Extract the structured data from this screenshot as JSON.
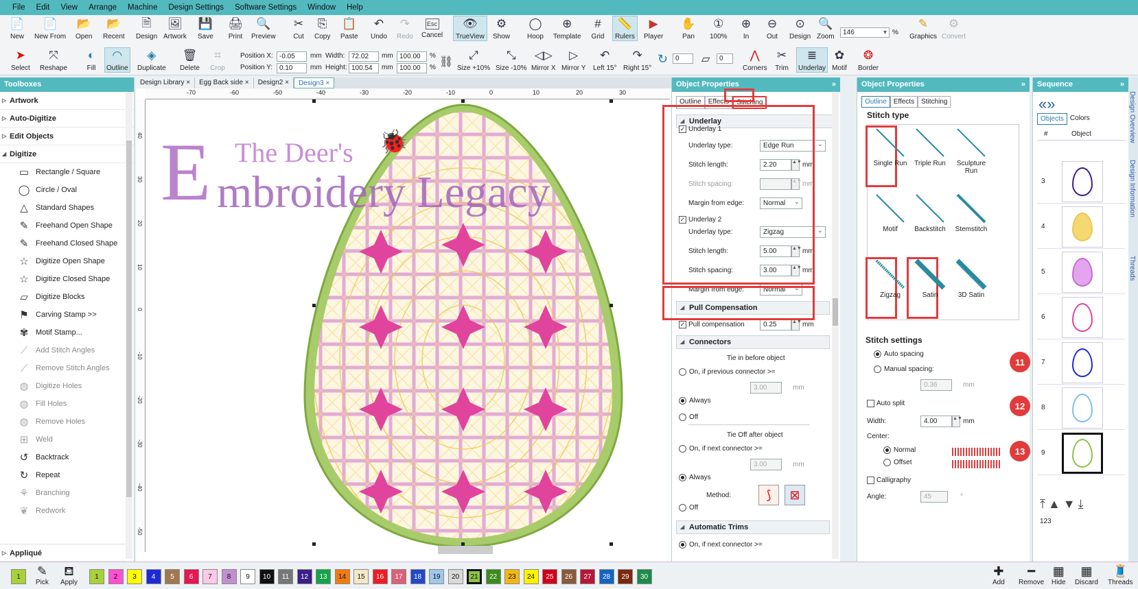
{
  "menu": [
    "File",
    "Edit",
    "View",
    "Arrange",
    "Machine",
    "Design Settings",
    "Software Settings",
    "Window",
    "Help"
  ],
  "toolbar1": [
    {
      "label": "New",
      "icon": "📄"
    },
    {
      "label": "New From",
      "icon": "📄"
    },
    {
      "label": "Open",
      "icon": "📂"
    },
    {
      "label": "Recent",
      "icon": "📂"
    },
    {
      "label": "Design",
      "icon": "🗎"
    },
    {
      "label": "Artwork",
      "icon": "🖼"
    },
    {
      "label": "Save",
      "icon": "💾"
    },
    {
      "label": "Print",
      "icon": "🖨"
    },
    {
      "label": "Preview",
      "icon": "🔍"
    },
    {
      "label": "Cut",
      "icon": "✂"
    },
    {
      "label": "Copy",
      "icon": "⎘"
    },
    {
      "label": "Paste",
      "icon": "📋"
    },
    {
      "label": "Undo",
      "icon": "↶"
    },
    {
      "label": "Redo",
      "icon": "↷"
    },
    {
      "label": "Cancel",
      "icon": "Esc"
    },
    {
      "label": "TrueView",
      "icon": "👁"
    },
    {
      "label": "Show",
      "icon": "⚙"
    },
    {
      "label": "Hoop",
      "icon": "◯"
    },
    {
      "label": "Template",
      "icon": "⊕"
    },
    {
      "label": "Grid",
      "icon": "#"
    },
    {
      "label": "Rulers",
      "icon": "📏"
    },
    {
      "label": "Player",
      "icon": "▶"
    },
    {
      "label": "Pan",
      "icon": "✋"
    },
    {
      "label": "100%",
      "icon": "①"
    },
    {
      "label": "In",
      "icon": "⊕"
    },
    {
      "label": "Out",
      "icon": "⊖"
    },
    {
      "label": "Design",
      "icon": "⊙"
    },
    {
      "label": "Zoom",
      "icon": "🔍"
    }
  ],
  "zoom_value": "146",
  "zoom_unit": "%",
  "graphics": "Graphics",
  "convert": "Convert",
  "toolbar2": [
    {
      "label": "Select",
      "icon": "➤"
    },
    {
      "label": "Reshape",
      "icon": "⤧"
    },
    {
      "label": "Fill",
      "icon": "◐"
    },
    {
      "label": "Outline",
      "icon": "◠"
    },
    {
      "label": "Duplicate",
      "icon": "◈"
    },
    {
      "label": "Delete",
      "icon": "🗑"
    },
    {
      "label": "Crop",
      "icon": "⌗"
    }
  ],
  "position": {
    "x_label": "Position X:",
    "x_value": "-0.05",
    "y_label": "Position Y:",
    "y_value": "0.10",
    "unit": "mm",
    "width_label": "Width:",
    "width_value": "72.02",
    "height_label": "Height:",
    "height_value": "100.54",
    "pct1": "100.00",
    "pct2": "100.00",
    "pct": "%"
  },
  "toolbar2b": [
    {
      "label": "Size +10%",
      "icon": "⤢"
    },
    {
      "label": "Size -10%",
      "icon": "⤡"
    },
    {
      "label": "Mirror X",
      "icon": "◁▷"
    },
    {
      "label": "Mirror Y",
      "icon": "▷"
    },
    {
      "label": "Left 15°",
      "icon": "↶"
    },
    {
      "label": "Right 15°",
      "icon": "↷"
    },
    {
      "label": "Corners",
      "icon": "⋀"
    },
    {
      "label": "Trim",
      "icon": "✂"
    },
    {
      "label": "Underlay",
      "icon": "≣"
    },
    {
      "label": "Motif",
      "icon": "✿"
    },
    {
      "label": "Border",
      "icon": "❂"
    }
  ],
  "rotate_value": "0",
  "slant_value": "0",
  "toolboxes": {
    "title": "Toolboxes",
    "sections": [
      "Artwork",
      "Auto-Digitize",
      "Edit Objects",
      "Digitize"
    ],
    "tools": [
      {
        "label": "Rectangle / Square",
        "icon": "▭",
        "dim": false
      },
      {
        "label": "Circle / Oval",
        "icon": "◯",
        "dim": false
      },
      {
        "label": "Standard Shapes",
        "icon": "△",
        "dim": false
      },
      {
        "label": "Freehand Open Shape",
        "icon": "✎",
        "dim": false
      },
      {
        "label": "Freehand Closed Shape",
        "icon": "✎",
        "dim": false
      },
      {
        "label": "Digitize Open Shape",
        "icon": "☆",
        "dim": false
      },
      {
        "label": "Digitize Closed Shape",
        "icon": "☆",
        "dim": false
      },
      {
        "label": "Digitize Blocks",
        "icon": "▱",
        "dim": false
      },
      {
        "label": "Carving Stamp >>",
        "icon": "⚑",
        "dim": false
      },
      {
        "label": "Motif Stamp...",
        "icon": "✾",
        "dim": false
      },
      {
        "label": "Add Stitch Angles",
        "icon": "⟋",
        "dim": true
      },
      {
        "label": "Remove Stitch Angles",
        "icon": "⟋",
        "dim": true
      },
      {
        "label": "Digitize Holes",
        "icon": "◍",
        "dim": true
      },
      {
        "label": "Fill Holes",
        "icon": "◍",
        "dim": true
      },
      {
        "label": "Remove Holes",
        "icon": "◍",
        "dim": true
      },
      {
        "label": "Weld",
        "icon": "⊞",
        "dim": true
      },
      {
        "label": "Backtrack",
        "icon": "↺",
        "dim": false
      },
      {
        "label": "Repeat",
        "icon": "↻",
        "dim": false
      },
      {
        "label": "Branching",
        "icon": "⚘",
        "dim": true
      },
      {
        "label": "Redwork",
        "icon": "❦",
        "dim": true
      }
    ],
    "last_section": "Appliqué"
  },
  "doc_tabs": [
    "Design Library ×",
    "Egg Back side ×",
    "Design2 ×",
    "Design3 ×"
  ],
  "ruler_h": [
    "-70",
    "-60",
    "-50",
    "-40",
    "-30",
    "-20",
    "-10",
    "0",
    "10",
    "20",
    "30"
  ],
  "ruler_v": [
    "40",
    "30",
    "20",
    "10",
    "0",
    "-10",
    "-20",
    "-30",
    "-40",
    "-50"
  ],
  "watermark": {
    "line1": "The Deer's",
    "big_letter": "E",
    "line2": "mbroidery Legacy"
  },
  "objprops": {
    "title": "Object Properties",
    "tabs": [
      "Outline",
      "Effects",
      "Stitching"
    ],
    "underlay_title": "Underlay",
    "u1": "Underlay 1",
    "u1_type_label": "Underlay type:",
    "u1_type": "Edge Run",
    "u1_len_label": "Stitch length:",
    "u1_len": "2.20",
    "u1_sp_label": "Stitch spacing:",
    "u1_margin_label": "Margin from edge:",
    "u1_margin": "Normal",
    "u2": "Underlay 2",
    "u2_type_label": "Underlay type:",
    "u2_type": "Zigzag",
    "u2_len_label": "Stitch length:",
    "u2_len": "5.00",
    "u2_sp_label": "Stitch spacing:",
    "u2_sp": "3.00",
    "u2_margin_label": "Margin from edge:",
    "u2_margin": "Normal",
    "mm": "mm",
    "pull_title": "Pull Compensation",
    "pull_label": "Pull compensation",
    "pull_value": "0.25",
    "connectors_title": "Connectors",
    "tie_in": "Tie in before object",
    "on_prev": "On, if previous connector >=",
    "on_prev_val": "3.00",
    "always": "Always",
    "off": "Off",
    "tie_off": "Tie Off after object",
    "on_next": "On, if next connector >=",
    "on_next_val": "3.00",
    "always2": "Always",
    "method": "Method:",
    "off2": "Off",
    "trims_title": "Automatic Trims",
    "on_next2": "On, if next connector >="
  },
  "objprops2": {
    "title": "Object Properties",
    "tabs": [
      "Outline",
      "Effects",
      "Stitching"
    ],
    "stitch_type_title": "Stitch type",
    "types": [
      "Single Run",
      "Triple Run",
      "Sculpture Run",
      "Motif",
      "Backstitch",
      "Stemstitch",
      "Zigzag",
      "Satin",
      "3D Satin"
    ],
    "settings_title": "Stitch settings",
    "auto_spacing": "Auto spacing",
    "manual_spacing": "Manual spacing:",
    "manual_val": "0.36",
    "mm": "mm",
    "auto_split": "Auto split",
    "width_label": "Width:",
    "width_val": "4.00",
    "center_label": "Center:",
    "normal": "Normal",
    "offset": "Offset",
    "calligraphy": "Calligraphy",
    "angle_label": "Angle:",
    "angle_val": "45",
    "deg": "°"
  },
  "sequence": {
    "title": "Sequence",
    "tabs": [
      "Objects",
      "Colors"
    ],
    "col_num": "#",
    "col_obj": "Object",
    "rows": [
      "3",
      "4",
      "5",
      "6",
      "7",
      "8",
      "9"
    ],
    "badges": [
      "11",
      "12",
      "13"
    ],
    "count": "123"
  },
  "side_tabs": [
    "Design Overview",
    "Design Information",
    "Threads"
  ],
  "palette": {
    "pick": "Pick",
    "apply": "Apply",
    "current": "1",
    "colors": [
      {
        "n": "1",
        "c": "#a9d13a"
      },
      {
        "n": "2",
        "c": "#ff4fd1"
      },
      {
        "n": "3",
        "c": "#ffff00"
      },
      {
        "n": "4",
        "c": "#1d2bd6"
      },
      {
        "n": "5",
        "c": "#a07850"
      },
      {
        "n": "6",
        "c": "#e8174f"
      },
      {
        "n": "7",
        "c": "#ffc8e6"
      },
      {
        "n": "8",
        "c": "#c28fd0"
      },
      {
        "n": "9",
        "c": "#ffffff"
      },
      {
        "n": "10",
        "c": "#111111"
      },
      {
        "n": "11",
        "c": "#777777"
      },
      {
        "n": "12",
        "c": "#3a1f8a"
      },
      {
        "n": "13",
        "c": "#16a34a"
      },
      {
        "n": "14",
        "c": "#f07c10"
      },
      {
        "n": "15",
        "c": "#f3e9c8"
      },
      {
        "n": "16",
        "c": "#ee1c25"
      },
      {
        "n": "17",
        "c": "#d8627a"
      },
      {
        "n": "18",
        "c": "#2548c8"
      },
      {
        "n": "19",
        "c": "#9fc7ea"
      },
      {
        "n": "20",
        "c": "#d9d9d9"
      },
      {
        "n": "21",
        "c": "#8bc34a"
      },
      {
        "n": "22",
        "c": "#3d8b1d"
      },
      {
        "n": "23",
        "c": "#f3b613"
      },
      {
        "n": "24",
        "c": "#fff200"
      },
      {
        "n": "25",
        "c": "#d0021b"
      },
      {
        "n": "26",
        "c": "#8a5a3c"
      },
      {
        "n": "27",
        "c": "#b5173a"
      },
      {
        "n": "28",
        "c": "#1565c0"
      },
      {
        "n": "29",
        "c": "#7b2a10"
      },
      {
        "n": "30",
        "c": "#1e8b4c"
      }
    ],
    "actions": [
      {
        "label": "Add",
        "icon": "✚"
      },
      {
        "label": "Remove",
        "icon": "━"
      },
      {
        "label": "Hide",
        "icon": "▦"
      },
      {
        "label": "Discard",
        "icon": "▦"
      },
      {
        "label": "Threads",
        "icon": "🧵"
      }
    ]
  },
  "colors": {
    "accent": "#52b9bf",
    "highlight": "#e23b3b"
  }
}
